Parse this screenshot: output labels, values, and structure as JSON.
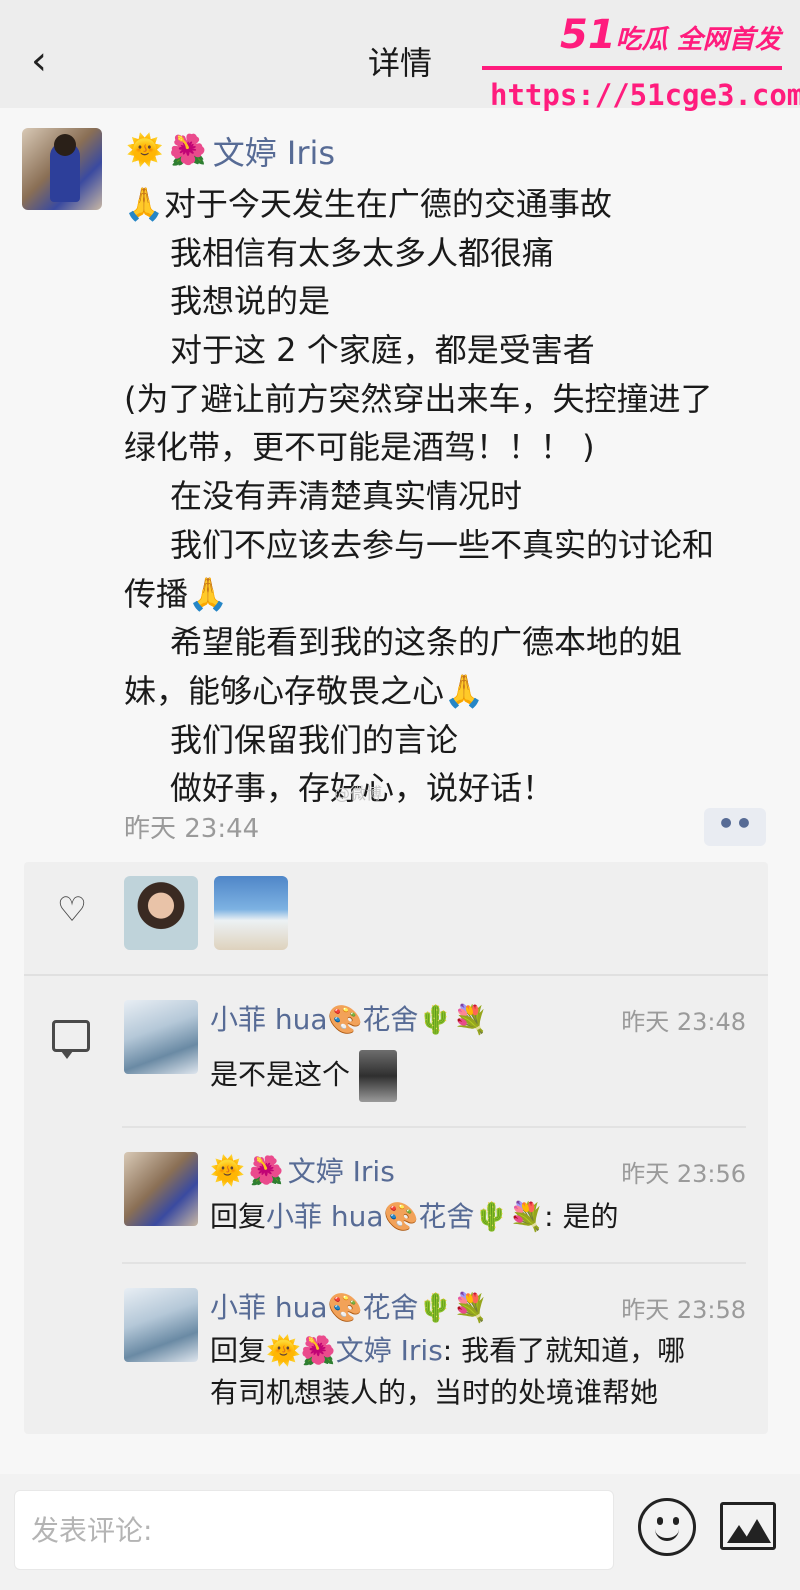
{
  "header": {
    "back_icon": "chevron-left-icon",
    "title": "详情"
  },
  "watermark": {
    "brand_num": "51",
    "brand_text": "吃瓜 全网首发",
    "url": "https://51cge3.com",
    "color": "#ff1c7d"
  },
  "post": {
    "author": {
      "emoji_sun": "🌞",
      "emoji_flower": "🌺",
      "name": "文婷 Iris"
    },
    "lines": [
      "🙏对于今天发生在广德的交通事故",
      "我相信有太多太多人都很痛",
      "我想说的是",
      "对于这 2 个家庭，都是受害者",
      "(为了避让前方突然穿出来车，失控撞进了",
      "绿化带，更不可能是酒驾！！！ )",
      "在没有弄清楚真实情况时",
      "我们不应该去参与一些不真实的讨论和",
      "传播🙏",
      "希望能看到我的这条的广德本地的姐",
      "妹，能够心存敬畏之心🙏",
      "我们保留我们的言论",
      "做好事，存好心，说好话！"
    ],
    "watermark_text": "@微博",
    "time": "昨天 23:44",
    "more_label": "••"
  },
  "likes": {
    "icon": "heart-icon"
  },
  "comments": [
    {
      "name": "小菲 hua🎨花舍🌵💐",
      "time": "昨天 23:48",
      "text": "是不是这个"
    },
    {
      "name_sun": "🌞",
      "name_flower": "🌺",
      "name": "文婷 Iris",
      "time": "昨天 23:56",
      "reply_prefix": "回复",
      "reply_to": "小菲 hua🎨花舍🌵💐",
      "text": ": 是的"
    },
    {
      "name": "小菲 hua🎨花舍🌵💐",
      "time": "昨天 23:58",
      "reply_prefix": "回复",
      "reply_to": "🌞🌺文婷 Iris",
      "text_line1": ": 我看了就知道，哪",
      "text_line2": "有司机想装人的，当时的处境谁帮她"
    }
  ],
  "input": {
    "placeholder": "发表评论:",
    "emoji_icon": "smiley-icon",
    "image_icon": "image-icon"
  },
  "colors": {
    "link_blue": "#576b95",
    "meta_gray": "#9a9a9a"
  }
}
